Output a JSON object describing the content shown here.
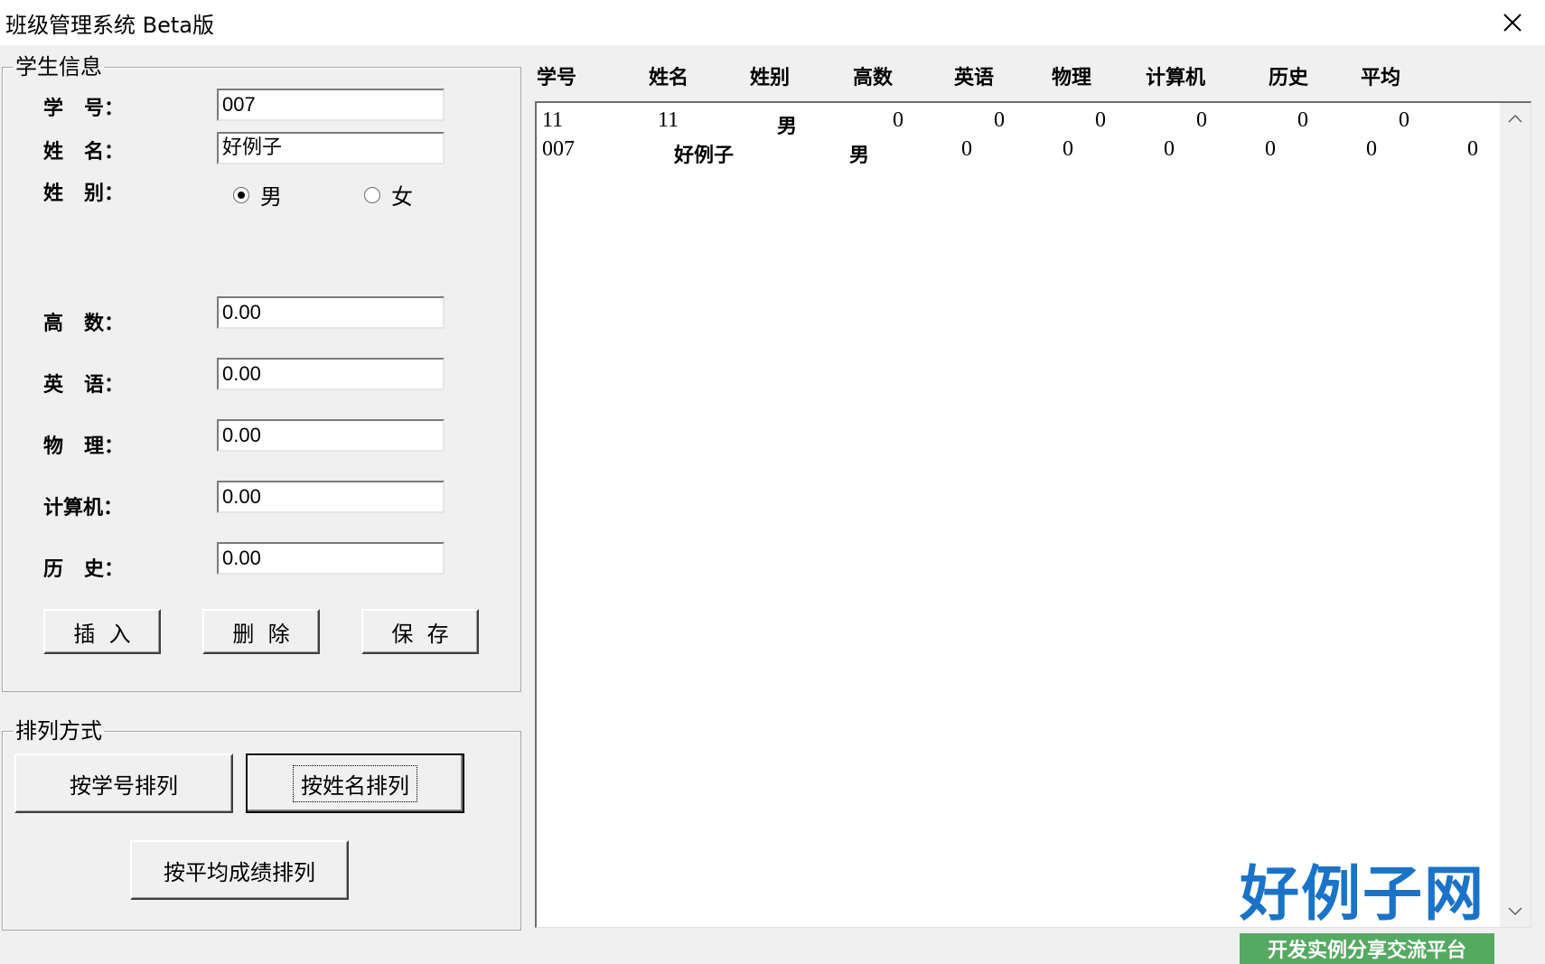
{
  "window": {
    "title": "班级管理系统  Beta版",
    "close_icon": "close-icon"
  },
  "student_info": {
    "legend": "学生信息",
    "id_label": "学   号：",
    "name_label": "姓   名：",
    "gender_label": "姓   别：",
    "id_value": "007",
    "name_value": "好例子",
    "gender_male": "男",
    "gender_female": "女",
    "gender_selected": "male",
    "math_label": "高   数：",
    "english_label": "英   语：",
    "physics_label": "物   理：",
    "computer_label": "计算机：",
    "history_label": "历   史：",
    "math_value": "0.00",
    "english_value": "0.00",
    "physics_value": "0.00",
    "computer_value": "0.00",
    "history_value": "0.00",
    "insert_btn": "插  入",
    "delete_btn": "删  除",
    "save_btn": "保  存"
  },
  "sort": {
    "legend": "排列方式",
    "by_id": "按学号排列",
    "by_name": "按姓名排列",
    "by_avg": "按平均成绩排列"
  },
  "list": {
    "headers": [
      "学号",
      "姓名",
      "姓别",
      "高数",
      "英语",
      "物理",
      "计算机",
      "历史",
      "平均"
    ],
    "rows": [
      [
        "11",
        "11",
        "男",
        "0",
        "0",
        "0",
        "0",
        "0",
        "0"
      ],
      [
        "007",
        "好例子",
        "男",
        "0",
        "0",
        "0",
        "0",
        "0",
        "0"
      ]
    ]
  },
  "watermark": {
    "title": "好例子网",
    "subtitle": "开发实例分享交流平台"
  }
}
